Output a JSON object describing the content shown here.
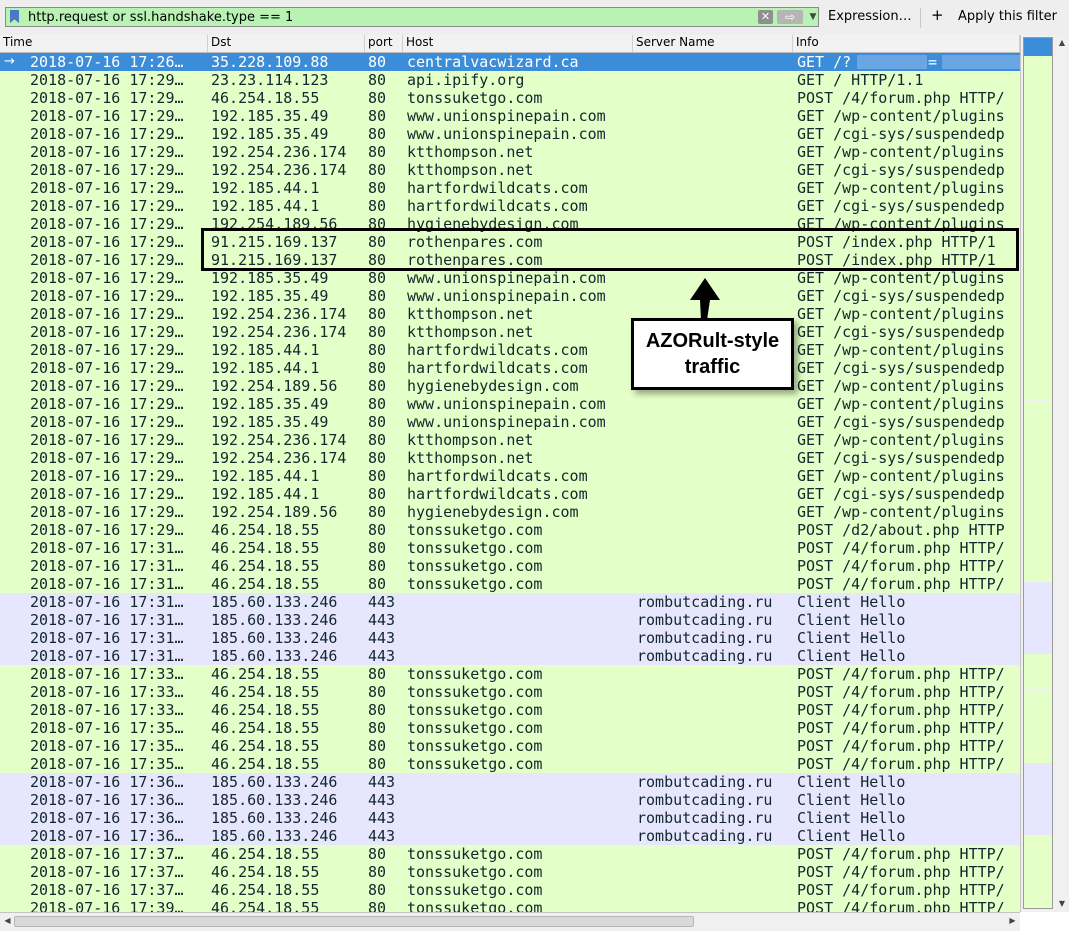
{
  "filter": {
    "value": "http.request or ssl.handshake.type == 1",
    "clear_icon": "clear-icon",
    "apply_icon": "arrow-right-icon",
    "expression_label": "Expression…",
    "add_label": "+",
    "apply_label": "Apply this filter"
  },
  "columns": {
    "time": "Time",
    "dst": "Dst",
    "port": "port",
    "host": "Host",
    "server": "Server Name",
    "info": "Info"
  },
  "colors": {
    "http_row": "#e4ffc7",
    "tls_row": "#e7e6ff",
    "selected_row": "#3c8dd9",
    "filter_valid": "#b9f3b3"
  },
  "packets": [
    {
      "time": "2018-07-16 17:26…",
      "dst": "35.228.109.88",
      "port": "80",
      "host": "centralvacwizard.ca",
      "server": "",
      "info": "GET /?",
      "type": "sel"
    },
    {
      "time": "2018-07-16 17:29…",
      "dst": "23.23.114.123",
      "port": "80",
      "host": "api.ipify.org",
      "server": "",
      "info": "GET / HTTP/1.1",
      "type": "http"
    },
    {
      "time": "2018-07-16 17:29…",
      "dst": "46.254.18.55",
      "port": "80",
      "host": "tonssuketgo.com",
      "server": "",
      "info": "POST /4/forum.php HTTP/",
      "type": "http"
    },
    {
      "time": "2018-07-16 17:29…",
      "dst": "192.185.35.49",
      "port": "80",
      "host": "www.unionspinepain.com",
      "server": "",
      "info": "GET /wp-content/plugins",
      "type": "http"
    },
    {
      "time": "2018-07-16 17:29…",
      "dst": "192.185.35.49",
      "port": "80",
      "host": "www.unionspinepain.com",
      "server": "",
      "info": "GET /cgi-sys/suspendedp",
      "type": "http"
    },
    {
      "time": "2018-07-16 17:29…",
      "dst": "192.254.236.174",
      "port": "80",
      "host": "ktthompson.net",
      "server": "",
      "info": "GET /wp-content/plugins",
      "type": "http"
    },
    {
      "time": "2018-07-16 17:29…",
      "dst": "192.254.236.174",
      "port": "80",
      "host": "ktthompson.net",
      "server": "",
      "info": "GET /cgi-sys/suspendedp",
      "type": "http"
    },
    {
      "time": "2018-07-16 17:29…",
      "dst": "192.185.44.1",
      "port": "80",
      "host": "hartfordwildcats.com",
      "server": "",
      "info": "GET /wp-content/plugins",
      "type": "http"
    },
    {
      "time": "2018-07-16 17:29…",
      "dst": "192.185.44.1",
      "port": "80",
      "host": "hartfordwildcats.com",
      "server": "",
      "info": "GET /cgi-sys/suspendedp",
      "type": "http"
    },
    {
      "time": "2018-07-16 17:29…",
      "dst": "192.254.189.56",
      "port": "80",
      "host": "hygienebydesign.com",
      "server": "",
      "info": "GET /wp-content/plugins",
      "type": "http"
    },
    {
      "time": "2018-07-16 17:29…",
      "dst": "91.215.169.137",
      "port": "80",
      "host": "rothenpares.com",
      "server": "",
      "info": "POST /index.php HTTP/1",
      "type": "http"
    },
    {
      "time": "2018-07-16 17:29…",
      "dst": "91.215.169.137",
      "port": "80",
      "host": "rothenpares.com",
      "server": "",
      "info": "POST /index.php HTTP/1",
      "type": "http"
    },
    {
      "time": "2018-07-16 17:29…",
      "dst": "192.185.35.49",
      "port": "80",
      "host": "www.unionspinepain.com",
      "server": "",
      "info": "GET /wp-content/plugins",
      "type": "http"
    },
    {
      "time": "2018-07-16 17:29…",
      "dst": "192.185.35.49",
      "port": "80",
      "host": "www.unionspinepain.com",
      "server": "",
      "info": "GET /cgi-sys/suspendedp",
      "type": "http"
    },
    {
      "time": "2018-07-16 17:29…",
      "dst": "192.254.236.174",
      "port": "80",
      "host": "ktthompson.net",
      "server": "",
      "info": "GET /wp-content/plugins",
      "type": "http"
    },
    {
      "time": "2018-07-16 17:29…",
      "dst": "192.254.236.174",
      "port": "80",
      "host": "ktthompson.net",
      "server": "",
      "info": "GET /cgi-sys/suspendedp",
      "type": "http"
    },
    {
      "time": "2018-07-16 17:29…",
      "dst": "192.185.44.1",
      "port": "80",
      "host": "hartfordwildcats.com",
      "server": "",
      "info": "GET /wp-content/plugins",
      "type": "http"
    },
    {
      "time": "2018-07-16 17:29…",
      "dst": "192.185.44.1",
      "port": "80",
      "host": "hartfordwildcats.com",
      "server": "",
      "info": "GET /cgi-sys/suspendedp",
      "type": "http"
    },
    {
      "time": "2018-07-16 17:29…",
      "dst": "192.254.189.56",
      "port": "80",
      "host": "hygienebydesign.com",
      "server": "",
      "info": "GET /wp-content/plugins",
      "type": "http"
    },
    {
      "time": "2018-07-16 17:29…",
      "dst": "192.185.35.49",
      "port": "80",
      "host": "www.unionspinepain.com",
      "server": "",
      "info": "GET /wp-content/plugins",
      "type": "http"
    },
    {
      "time": "2018-07-16 17:29…",
      "dst": "192.185.35.49",
      "port": "80",
      "host": "www.unionspinepain.com",
      "server": "",
      "info": "GET /cgi-sys/suspendedp",
      "type": "http"
    },
    {
      "time": "2018-07-16 17:29…",
      "dst": "192.254.236.174",
      "port": "80",
      "host": "ktthompson.net",
      "server": "",
      "info": "GET /wp-content/plugins",
      "type": "http"
    },
    {
      "time": "2018-07-16 17:29…",
      "dst": "192.254.236.174",
      "port": "80",
      "host": "ktthompson.net",
      "server": "",
      "info": "GET /cgi-sys/suspendedp",
      "type": "http"
    },
    {
      "time": "2018-07-16 17:29…",
      "dst": "192.185.44.1",
      "port": "80",
      "host": "hartfordwildcats.com",
      "server": "",
      "info": "GET /wp-content/plugins",
      "type": "http"
    },
    {
      "time": "2018-07-16 17:29…",
      "dst": "192.185.44.1",
      "port": "80",
      "host": "hartfordwildcats.com",
      "server": "",
      "info": "GET /cgi-sys/suspendedp",
      "type": "http"
    },
    {
      "time": "2018-07-16 17:29…",
      "dst": "192.254.189.56",
      "port": "80",
      "host": "hygienebydesign.com",
      "server": "",
      "info": "GET /wp-content/plugins",
      "type": "http"
    },
    {
      "time": "2018-07-16 17:29…",
      "dst": "46.254.18.55",
      "port": "80",
      "host": "tonssuketgo.com",
      "server": "",
      "info": "POST /d2/about.php HTTP",
      "type": "http"
    },
    {
      "time": "2018-07-16 17:31…",
      "dst": "46.254.18.55",
      "port": "80",
      "host": "tonssuketgo.com",
      "server": "",
      "info": "POST /4/forum.php HTTP/",
      "type": "http"
    },
    {
      "time": "2018-07-16 17:31…",
      "dst": "46.254.18.55",
      "port": "80",
      "host": "tonssuketgo.com",
      "server": "",
      "info": "POST /4/forum.php HTTP/",
      "type": "http"
    },
    {
      "time": "2018-07-16 17:31…",
      "dst": "46.254.18.55",
      "port": "80",
      "host": "tonssuketgo.com",
      "server": "",
      "info": "POST /4/forum.php HTTP/",
      "type": "http"
    },
    {
      "time": "2018-07-16 17:31…",
      "dst": "185.60.133.246",
      "port": "443",
      "host": "",
      "server": "rombutcading.ru",
      "info": "Client Hello",
      "type": "tls"
    },
    {
      "time": "2018-07-16 17:31…",
      "dst": "185.60.133.246",
      "port": "443",
      "host": "",
      "server": "rombutcading.ru",
      "info": "Client Hello",
      "type": "tls"
    },
    {
      "time": "2018-07-16 17:31…",
      "dst": "185.60.133.246",
      "port": "443",
      "host": "",
      "server": "rombutcading.ru",
      "info": "Client Hello",
      "type": "tls"
    },
    {
      "time": "2018-07-16 17:31…",
      "dst": "185.60.133.246",
      "port": "443",
      "host": "",
      "server": "rombutcading.ru",
      "info": "Client Hello",
      "type": "tls"
    },
    {
      "time": "2018-07-16 17:33…",
      "dst": "46.254.18.55",
      "port": "80",
      "host": "tonssuketgo.com",
      "server": "",
      "info": "POST /4/forum.php HTTP/",
      "type": "http"
    },
    {
      "time": "2018-07-16 17:33…",
      "dst": "46.254.18.55",
      "port": "80",
      "host": "tonssuketgo.com",
      "server": "",
      "info": "POST /4/forum.php HTTP/",
      "type": "http"
    },
    {
      "time": "2018-07-16 17:33…",
      "dst": "46.254.18.55",
      "port": "80",
      "host": "tonssuketgo.com",
      "server": "",
      "info": "POST /4/forum.php HTTP/",
      "type": "http"
    },
    {
      "time": "2018-07-16 17:35…",
      "dst": "46.254.18.55",
      "port": "80",
      "host": "tonssuketgo.com",
      "server": "",
      "info": "POST /4/forum.php HTTP/",
      "type": "http"
    },
    {
      "time": "2018-07-16 17:35…",
      "dst": "46.254.18.55",
      "port": "80",
      "host": "tonssuketgo.com",
      "server": "",
      "info": "POST /4/forum.php HTTP/",
      "type": "http"
    },
    {
      "time": "2018-07-16 17:35…",
      "dst": "46.254.18.55",
      "port": "80",
      "host": "tonssuketgo.com",
      "server": "",
      "info": "POST /4/forum.php HTTP/",
      "type": "http"
    },
    {
      "time": "2018-07-16 17:36…",
      "dst": "185.60.133.246",
      "port": "443",
      "host": "",
      "server": "rombutcading.ru",
      "info": "Client Hello",
      "type": "tls"
    },
    {
      "time": "2018-07-16 17:36…",
      "dst": "185.60.133.246",
      "port": "443",
      "host": "",
      "server": "rombutcading.ru",
      "info": "Client Hello",
      "type": "tls"
    },
    {
      "time": "2018-07-16 17:36…",
      "dst": "185.60.133.246",
      "port": "443",
      "host": "",
      "server": "rombutcading.ru",
      "info": "Client Hello",
      "type": "tls"
    },
    {
      "time": "2018-07-16 17:36…",
      "dst": "185.60.133.246",
      "port": "443",
      "host": "",
      "server": "rombutcading.ru",
      "info": "Client Hello",
      "type": "tls"
    },
    {
      "time": "2018-07-16 17:37…",
      "dst": "46.254.18.55",
      "port": "80",
      "host": "tonssuketgo.com",
      "server": "",
      "info": "POST /4/forum.php HTTP/",
      "type": "http"
    },
    {
      "time": "2018-07-16 17:37…",
      "dst": "46.254.18.55",
      "port": "80",
      "host": "tonssuketgo.com",
      "server": "",
      "info": "POST /4/forum.php HTTP/",
      "type": "http"
    },
    {
      "time": "2018-07-16 17:37…",
      "dst": "46.254.18.55",
      "port": "80",
      "host": "tonssuketgo.com",
      "server": "",
      "info": "POST /4/forum.php HTTP/",
      "type": "http"
    },
    {
      "time": "2018-07-16 17:39…",
      "dst": "46.254.18.55",
      "port": "80",
      "host": "tonssuketgo.com",
      "server": "",
      "info": "POST /4/forum.php HTTP/",
      "type": "http"
    }
  ],
  "annotation": {
    "line1": "AZORult-style",
    "line2": "traffic"
  }
}
